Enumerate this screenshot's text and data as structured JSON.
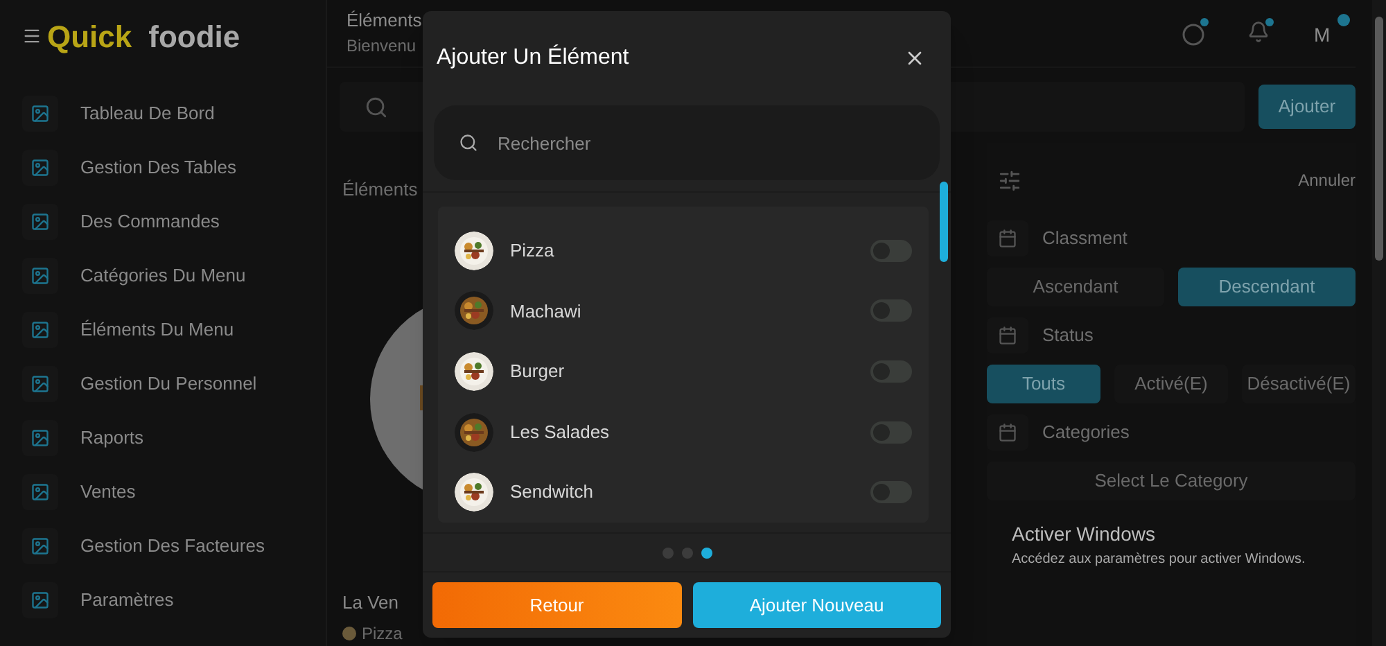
{
  "sidebar": {
    "brand": [
      "Quick",
      "foodie"
    ],
    "items": [
      {
        "label": "Tableau De Bord",
        "selected": false
      },
      {
        "label": "Gestion Des Tables",
        "selected": false
      },
      {
        "label": "Des Commandes",
        "selected": false
      },
      {
        "label": "Catégories Du Menu",
        "selected": false
      },
      {
        "label": "Éléments Du Menu",
        "selected": false
      },
      {
        "label": "Gestion Du Personnel",
        "selected": false
      },
      {
        "label": "Raports",
        "selected": false
      },
      {
        "label": "Ventes",
        "selected": false
      },
      {
        "label": "Gestion Des Facteures",
        "selected": false
      },
      {
        "label": "Paramètres",
        "selected": false
      }
    ]
  },
  "header": {
    "title": "Éléments",
    "subtitle": "Bienvenu",
    "avatar": "M"
  },
  "toolbar": {
    "add_button": "Ajouter",
    "section_label": "Éléments",
    "cancel": "Annuler"
  },
  "card": {
    "title": "La Ven",
    "category": "Pizza"
  },
  "filters": [
    {
      "label": "Classment",
      "options": [
        {
          "label": "Ascendant",
          "selected": false
        },
        {
          "label": "Descendant",
          "selected": true
        }
      ]
    },
    {
      "label": "Status",
      "options": [
        {
          "label": "Touts",
          "selected": true
        },
        {
          "label": "Activé(E)",
          "selected": false
        },
        {
          "label": "Désactivé(E)",
          "selected": false
        }
      ]
    },
    {
      "label": "Categories",
      "select": "Select Le Category"
    }
  ],
  "os_notice": {
    "title": "Activer Windows",
    "text": "Accédez aux paramètres pour activer Windows."
  },
  "modal": {
    "title": "Ajouter Un Élément",
    "search": {
      "placeholder": "Rechercher"
    },
    "items": [
      {
        "name": "Pizza",
        "on": false
      },
      {
        "name": "Machawi",
        "on": false
      },
      {
        "name": "Burger",
        "on": false
      },
      {
        "name": "Les Salades",
        "on": false
      },
      {
        "name": "Sendwitch",
        "on": false
      }
    ],
    "pages": [
      {
        "selected": false
      },
      {
        "selected": false
      },
      {
        "selected": true
      }
    ],
    "buttons": [
      "Retour",
      "Ajouter Nouveau"
    ]
  }
}
